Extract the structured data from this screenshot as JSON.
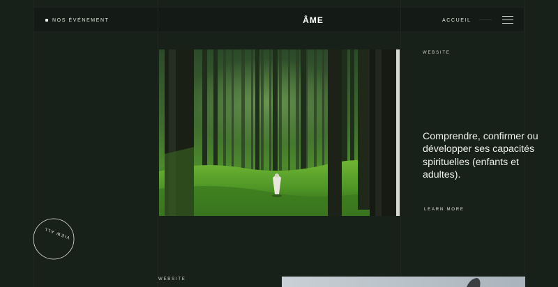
{
  "header": {
    "events_label": "NOS ÉVÉNEMENT",
    "logo": "ÂME",
    "home_label": "ACCUEIL"
  },
  "hero": {
    "tag": "WEBSITE",
    "headline": "Comprendre, confirmer ou développer ses capacités spirituelles (enfants et adultes).",
    "cta": "LEARN MORE"
  },
  "badge": {
    "text": "VIEW ALL"
  },
  "next_section": {
    "tag": "WEBSITE"
  },
  "colors": {
    "background": "#18201a",
    "header_bg": "#141b16",
    "text": "#e8ebe6"
  }
}
